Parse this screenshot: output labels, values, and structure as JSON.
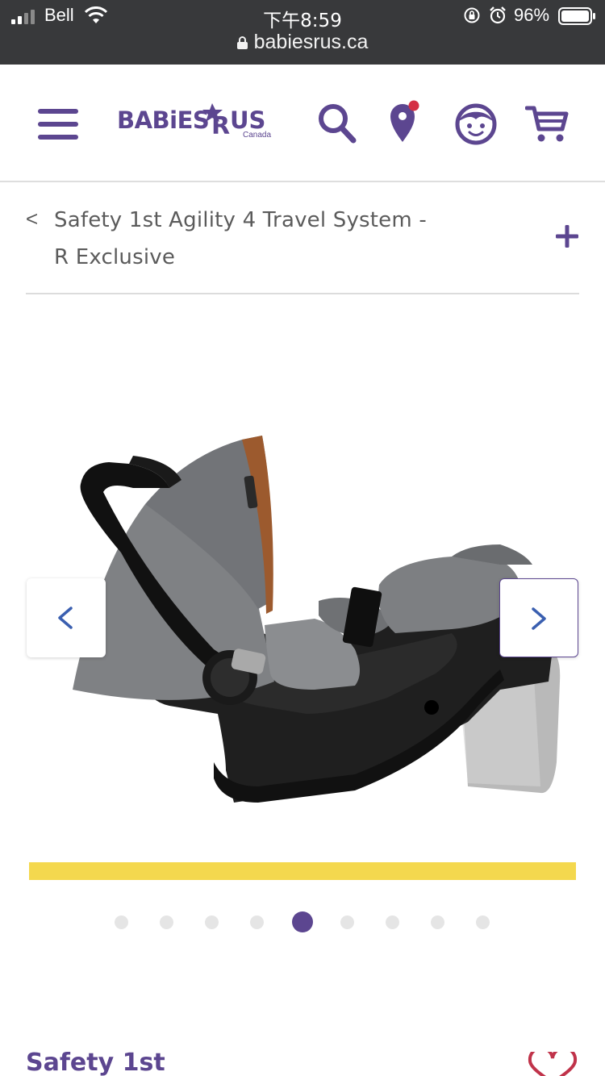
{
  "status_bar": {
    "carrier": "Bell",
    "time": "下午8:59",
    "battery_percent": "96%",
    "battery_level": 0.96,
    "icons": [
      "signal-icon",
      "wifi-icon",
      "orientation-lock-icon",
      "alarm-icon",
      "battery-icon"
    ]
  },
  "browser": {
    "url": "babiesrus.ca"
  },
  "header": {
    "logo_text": "BABIES R US",
    "logo_subtext": "Canada",
    "icons": [
      "menu-icon",
      "search-icon",
      "store-locator-icon",
      "account-icon",
      "cart-icon"
    ],
    "colors": {
      "brand": "#5c4690",
      "notification": "#d42f44"
    }
  },
  "breadcrumb": {
    "back_label": "<",
    "title": "Safety 1st Agility 4 Travel System - R Exclusive",
    "expand_label": "+"
  },
  "gallery": {
    "slide_count": 9,
    "active_index": 4,
    "accent_bar_color": "#f4d84e"
  },
  "product": {
    "brand": "Safety 1st"
  }
}
